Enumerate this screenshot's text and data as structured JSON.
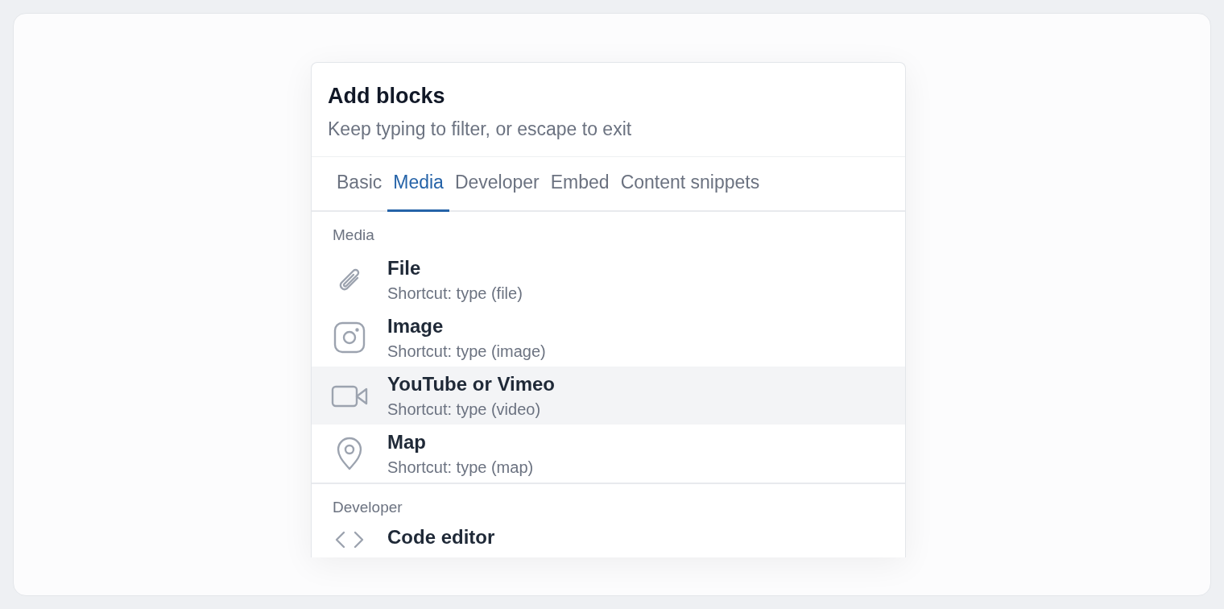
{
  "panel": {
    "title": "Add blocks",
    "subtitle": "Keep typing to filter, or escape to exit"
  },
  "tabs": [
    {
      "label": "Basic",
      "selected": false
    },
    {
      "label": "Media",
      "selected": true
    },
    {
      "label": "Developer",
      "selected": false
    },
    {
      "label": "Embed",
      "selected": false
    },
    {
      "label": "Content snippets",
      "selected": false
    }
  ],
  "sections": [
    {
      "label": "Media",
      "items": [
        {
          "kind": "file",
          "title": "File",
          "shortcut": "Shortcut: type (file)",
          "selected": false
        },
        {
          "kind": "image",
          "title": "Image",
          "shortcut": "Shortcut: type (image)",
          "selected": false
        },
        {
          "kind": "video",
          "title": "YouTube or Vimeo",
          "shortcut": "Shortcut: type (video)",
          "selected": true
        },
        {
          "kind": "map",
          "title": "Map",
          "shortcut": "Shortcut: type (map)",
          "selected": false
        }
      ]
    },
    {
      "label": "Developer",
      "items": [
        {
          "kind": "code",
          "title": "Code editor",
          "selected": false
        }
      ]
    }
  ]
}
